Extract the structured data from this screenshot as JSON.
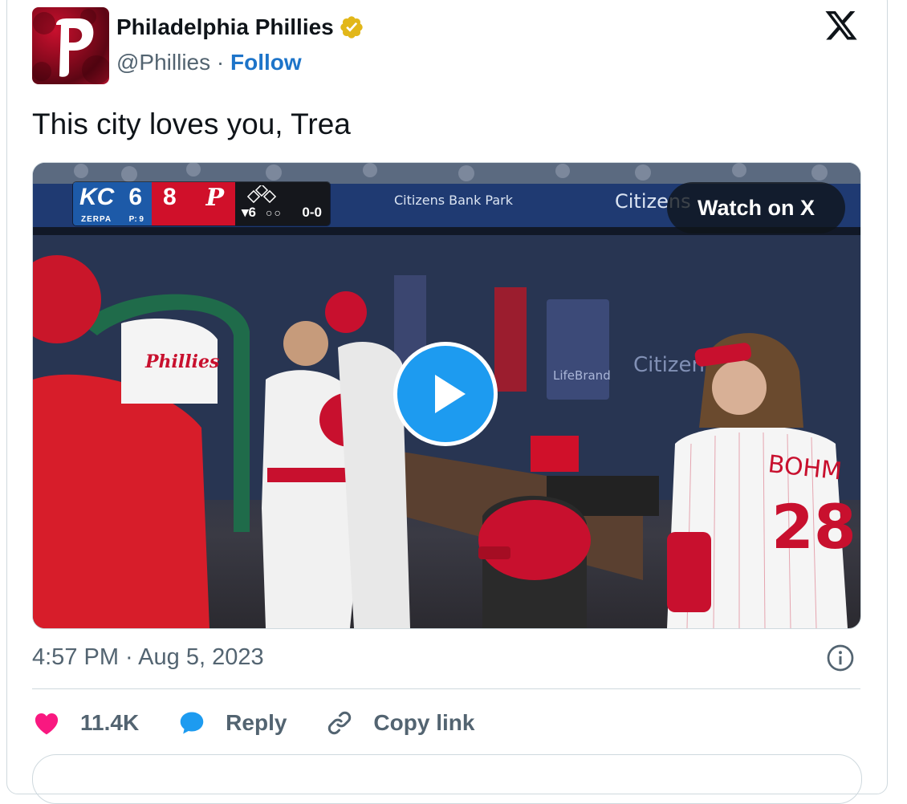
{
  "tweet": {
    "author_name": "Philadelphia Phillies",
    "handle": "@Phillies",
    "separator": " · ",
    "follow_label": "Follow",
    "text": "This city loves you, Trea",
    "timestamp": "4:57 PM · Aug 5, 2023"
  },
  "media": {
    "watch_label": "Watch on X",
    "scorebug": {
      "away_team": "KC",
      "away_score": "6",
      "away_pitcher": "ZERPA",
      "pitch_count": "P: 9",
      "home_team": "P",
      "home_score": "8",
      "inning": "▾6",
      "outs": "○○",
      "count": "0-0"
    },
    "signage": [
      "Citizens Bank Park",
      "Citizens",
      "LifeBrand",
      "Citizens"
    ],
    "jersey": {
      "name": "BOHM",
      "number": "28"
    }
  },
  "actions": {
    "likes_count": "11.4K",
    "reply_label": "Reply",
    "copy_link_label": "Copy link"
  },
  "colors": {
    "like": "#f91880",
    "reply": "#1d9bf0",
    "follow": "#1d74c9",
    "verified": "#e2b719",
    "phillies_red": "#d0102a",
    "royals_blue": "#1d5aa8"
  },
  "icons": [
    "x-logo-icon",
    "verified-badge-icon",
    "play-icon",
    "info-icon",
    "heart-icon",
    "reply-bubble-icon",
    "link-icon"
  ]
}
